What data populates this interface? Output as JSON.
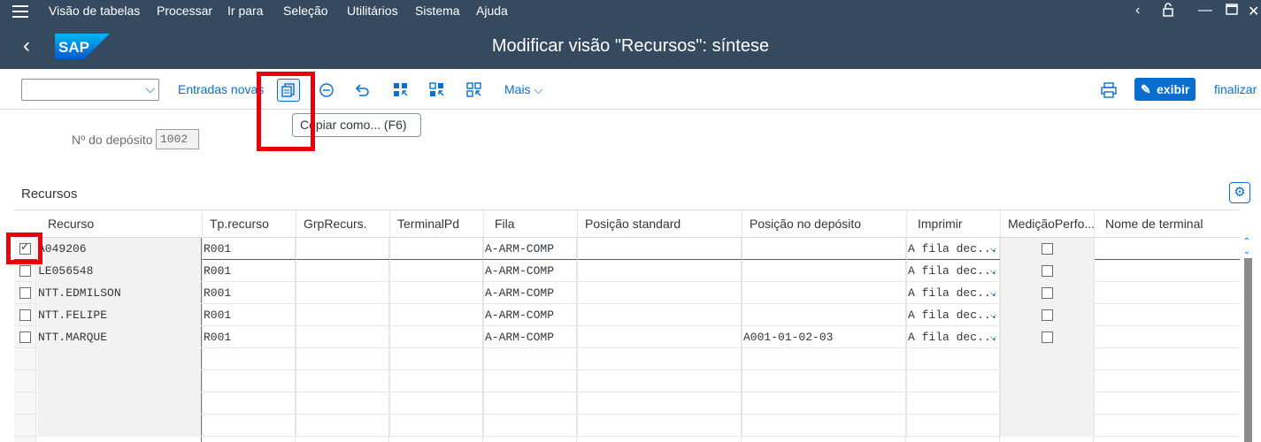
{
  "menubar": {
    "items": [
      "Visão de tabelas",
      "Processar",
      "Ir para",
      "Seleção",
      "Utilitários",
      "Sistema",
      "Ajuda"
    ]
  },
  "header": {
    "title": "Modificar visão \"Recursos\": síntese",
    "logo": "SAP"
  },
  "toolbar": {
    "entradas_novas": "Entradas novas",
    "mais": "Mais",
    "exibir": "exibir",
    "finalizar": "finalizar"
  },
  "tooltip": "Copiar como...   (F6)",
  "form": {
    "deposito_label": "Nº do depósito",
    "deposito_value": "1002"
  },
  "section_title": "Recursos",
  "table": {
    "columns": [
      "Recurso",
      "Tp.recurso",
      "GrpRecurs.",
      "TerminalPd",
      "Fila",
      "Posição standard",
      "Posição no depósito",
      "Imprimir",
      "MediçãoPerfo...",
      "Nome de terminal"
    ],
    "rows": [
      {
        "selected": true,
        "recurso": "A049206",
        "tp": "R001",
        "grp": "",
        "terminal": "",
        "fila": "A-ARM-COMP",
        "pos_std": "",
        "pos_dep": "",
        "imprimir": "A fila dec...",
        "medicao": false,
        "nome": ""
      },
      {
        "selected": false,
        "recurso": "LE056548",
        "tp": "R001",
        "grp": "",
        "terminal": "",
        "fila": "A-ARM-COMP",
        "pos_std": "",
        "pos_dep": "",
        "imprimir": "A fila dec...",
        "medicao": false,
        "nome": ""
      },
      {
        "selected": false,
        "recurso": "NTT.EDMILSON",
        "tp": "R001",
        "grp": "",
        "terminal": "",
        "fila": "A-ARM-COMP",
        "pos_std": "",
        "pos_dep": "",
        "imprimir": "A fila dec...",
        "medicao": false,
        "nome": ""
      },
      {
        "selected": false,
        "recurso": "NTT.FELIPE",
        "tp": "R001",
        "grp": "",
        "terminal": "",
        "fila": "A-ARM-COMP",
        "pos_std": "",
        "pos_dep": "",
        "imprimir": "A fila dec...",
        "medicao": false,
        "nome": ""
      },
      {
        "selected": false,
        "recurso": "NTT.MARQUE",
        "tp": "R001",
        "grp": "",
        "terminal": "",
        "fila": "A-ARM-COMP",
        "pos_std": "",
        "pos_dep": "A001-01-02-03",
        "imprimir": "A fila dec...",
        "medicao": false,
        "nome": ""
      }
    ]
  },
  "colors": {
    "shell": "#354a5f",
    "accent": "#0a6ed1",
    "highlight": "#e8000b"
  }
}
